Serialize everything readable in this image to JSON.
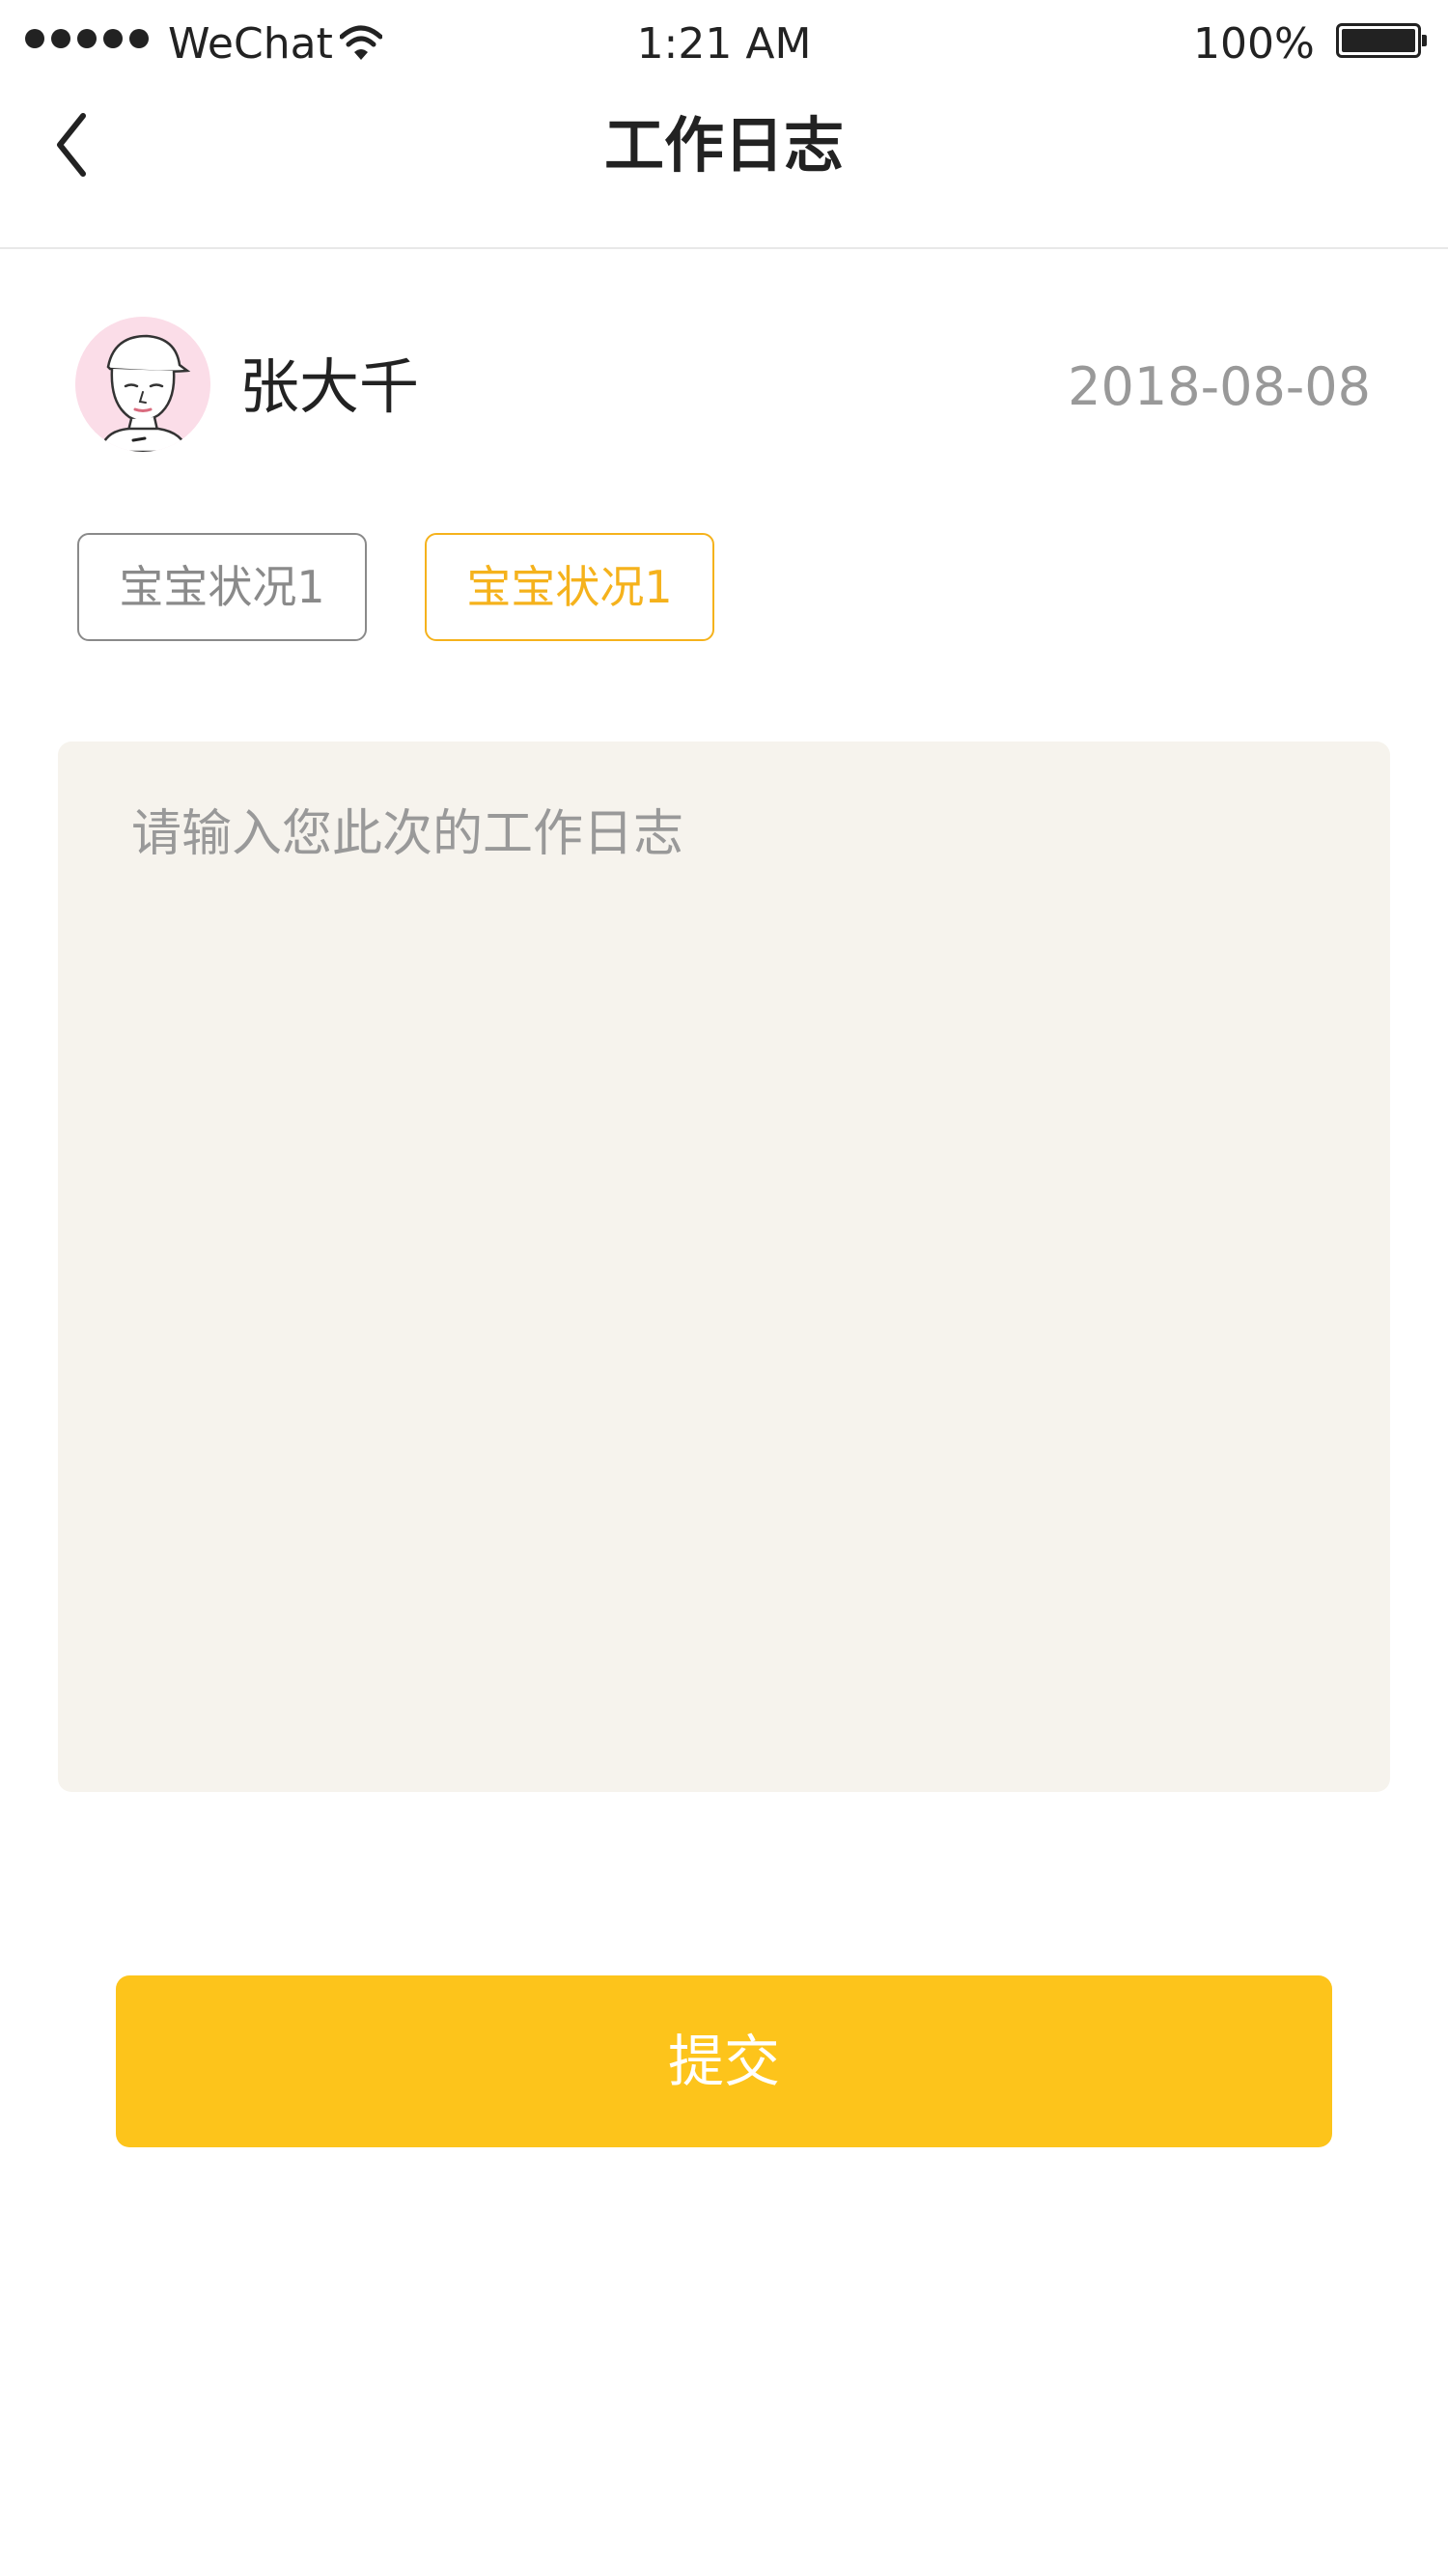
{
  "status_bar": {
    "carrier": "WeChat",
    "time": "1:21 AM",
    "battery": "100%",
    "signal_icon": "signal-dots-icon",
    "wifi_icon": "wifi-icon",
    "battery_icon": "battery-icon",
    "battery_level": 1.0
  },
  "nav": {
    "title": "工作日志",
    "back_icon": "chevron-left-icon"
  },
  "user": {
    "name": "张大千",
    "date": "2018-08-08",
    "avatar_icon": "avatar-illustration"
  },
  "tags": [
    {
      "label": "宝宝状况1",
      "selected": false,
      "color": "#8a8a8a"
    },
    {
      "label": "宝宝状况1",
      "selected": true,
      "color": "#f5b21c"
    }
  ],
  "log_input": {
    "value": "",
    "placeholder": "请输入您此次的工作日志"
  },
  "submit": {
    "label": "提交"
  },
  "colors": {
    "accent": "#fdc41b",
    "tag_selected": "#f5b21c",
    "input_background": "#f6f3ed",
    "date_text": "#999999"
  }
}
